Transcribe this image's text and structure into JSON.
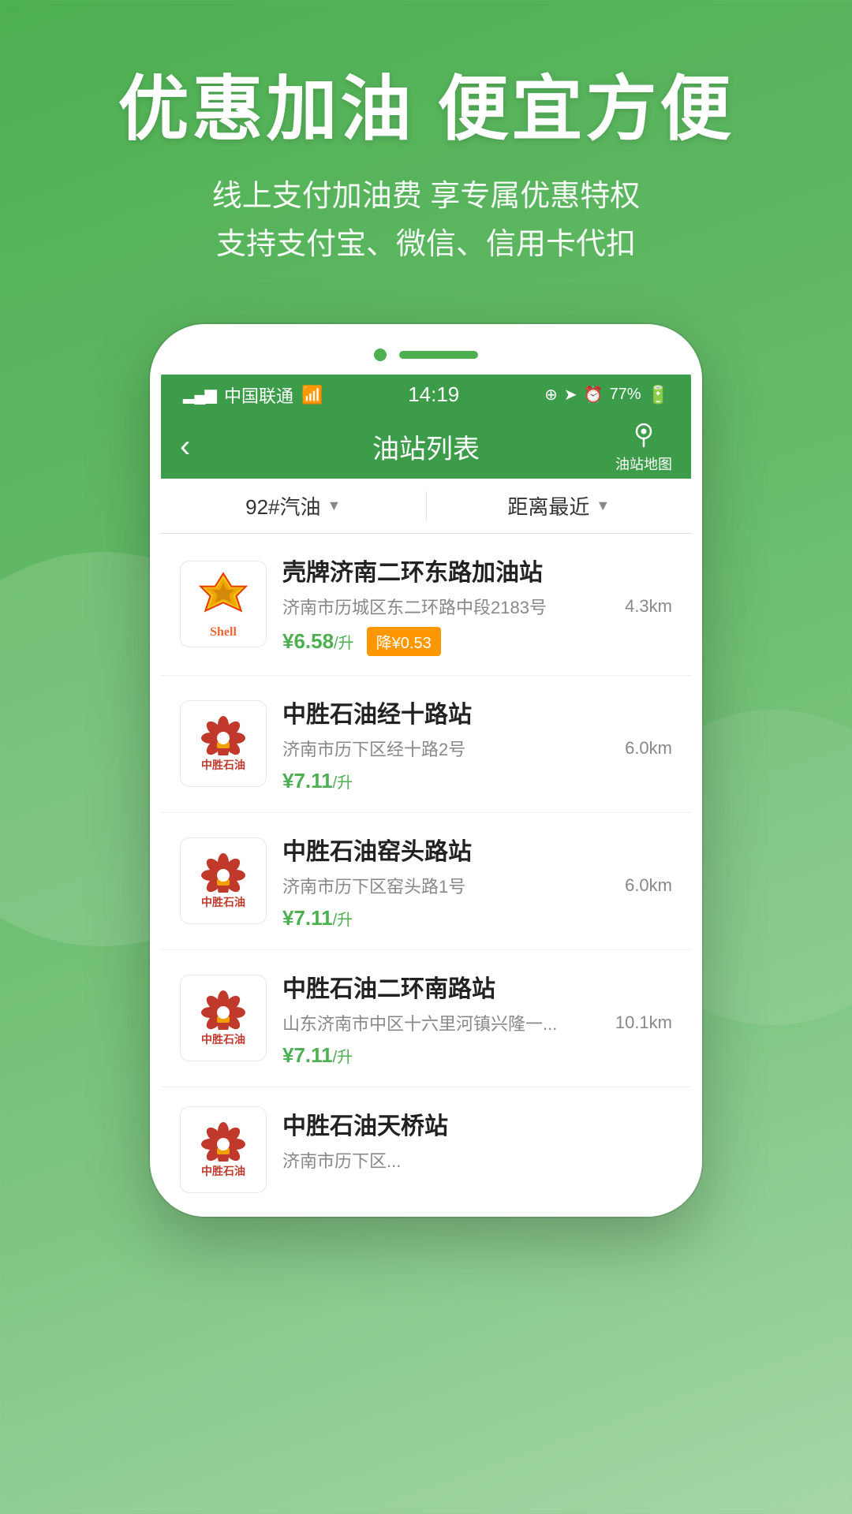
{
  "background": {
    "gradient_start": "#4caf50",
    "gradient_end": "#81c784"
  },
  "hero": {
    "title": "优惠加油 便宜方便",
    "subtitle_line1": "线上支付加油费 享专属优惠特权",
    "subtitle_line2": "支持支付宝、微信、信用卡代扣"
  },
  "phone": {
    "status_bar": {
      "carrier": "中国联通",
      "wifi_icon": "wifi",
      "time": "14:19",
      "location_icon": "location",
      "alarm_icon": "alarm",
      "battery": "77%"
    },
    "nav": {
      "back_label": "‹",
      "title": "油站列表",
      "map_icon": "map-pin",
      "map_label": "油站地图"
    },
    "filters": {
      "fuel_type": "92#汽油",
      "sort": "距离最近"
    },
    "stations": [
      {
        "brand": "Shell",
        "name": "壳牌济南二环东路加油站",
        "address": "济南市历城区东二环路中段2183号",
        "distance": "4.3km",
        "price": "¥6.58",
        "unit": "/升",
        "discount": "降¥0.53",
        "has_discount": true
      },
      {
        "brand": "中胜石油",
        "name": "中胜石油经十路站",
        "address": "济南市历下区经十路2号",
        "distance": "6.0km",
        "price": "¥7.11",
        "unit": "/升",
        "has_discount": false
      },
      {
        "brand": "中胜石油",
        "name": "中胜石油窑头路站",
        "address": "济南市历下区窑头路1号",
        "distance": "6.0km",
        "price": "¥7.11",
        "unit": "/升",
        "has_discount": false
      },
      {
        "brand": "中胜石油",
        "name": "中胜石油二环南路站",
        "address": "山东济南市中区十六里河镇兴隆一...",
        "distance": "10.1km",
        "price": "¥7.11",
        "unit": "/升",
        "has_discount": false
      },
      {
        "brand": "中胜石油",
        "name": "中胜石油天桥站",
        "address": "济南市历下区...",
        "distance": "",
        "price": "",
        "unit": "",
        "has_discount": false,
        "partial": true
      }
    ]
  }
}
